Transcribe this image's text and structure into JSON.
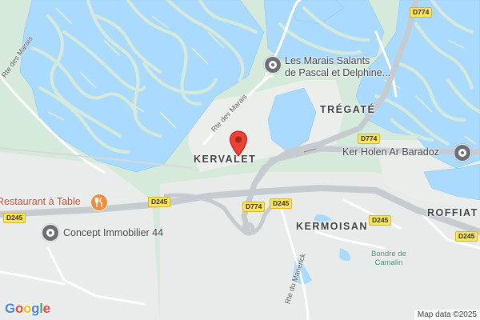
{
  "map": {
    "places": {
      "kervalet": "KERVALET",
      "tregate": "TRÉGATÉ",
      "kermoisan": "KERMOISAN",
      "roffiat": "ROFFIAT"
    },
    "pois": {
      "marais_salants": [
        "Les Marais Salants",
        "de Pascal et Delphine..."
      ],
      "ker_holen": "Ker Holen Ar Baradoz",
      "restaurant": "Restaurant à Table",
      "concept_immobilier": "Concept Immobilier 44"
    },
    "natural_label": [
      "Bondre de",
      "Camalin"
    ],
    "streets": {
      "rte_des_marais_left": "Rte des Marais",
      "rte_des_marais_mid": "Rte des Marais",
      "rte_du_manerick": "Rte du Manerick"
    },
    "route_shields": {
      "d774_top": "D774",
      "d774_mid": "D774",
      "d774_low": "D774",
      "d245_left": "D245",
      "d245_mid": "D245",
      "d245_center": "D245",
      "d245_right": "D245",
      "d245_far": "D245"
    },
    "branding": {
      "logo_letters": [
        "G",
        "o",
        "o",
        "g",
        "l",
        "e"
      ],
      "logo_colors": [
        "#4285f4",
        "#ea4335",
        "#fbbc05",
        "#4285f4",
        "#34a853",
        "#ea4335"
      ],
      "attribution": "Map data ©2025"
    },
    "icons": {
      "location_pin": "red-location-pin",
      "poi_marker": "grey-poi-marker",
      "restaurant_marker": "fork-knife-icon"
    },
    "colors": {
      "water": "#aadaff",
      "park": "#c8e6cf",
      "land": "#e8ebe8",
      "road": "#ffffff",
      "highway": "#f5d76b",
      "pin": "#ea4335"
    }
  }
}
